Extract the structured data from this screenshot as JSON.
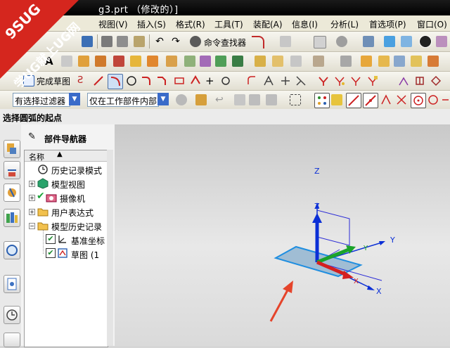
{
  "window": {
    "title": "g3.prt （修改的）]"
  },
  "menu": {
    "items": [
      "视图(V)",
      "插入(S)",
      "格式(R)",
      "工具(T)",
      "装配(A)",
      "信息(I)",
      "分析(L)",
      "首选项(P)",
      "窗口(O)"
    ]
  },
  "toolbar1": {
    "command_finder_label": "命令查找器"
  },
  "toolbar3": {
    "finish_sketch_label": "完成草图"
  },
  "selection_bar": {
    "filter_value": "有选择过滤器",
    "scope_value": "仅在工作部件内部"
  },
  "cue_line": {
    "text": "选择圆弧的起点"
  },
  "navigator": {
    "title": "部件导航器",
    "column_name": "名称",
    "items": [
      {
        "label": "历史记录模式"
      },
      {
        "label": "模型视图"
      },
      {
        "label": "摄像机"
      },
      {
        "label": "用户表达式"
      },
      {
        "label": "模型历史记录"
      },
      {
        "label": "基准坐标"
      },
      {
        "label": "草图 (1"
      }
    ]
  },
  "viewport": {
    "axis_labels": {
      "z_upper": "Z",
      "z_lower": "Z",
      "y": "Y",
      "y_small": "Y",
      "x": "X",
      "x_small": "X"
    }
  },
  "watermark": {
    "line1": "9SUG",
    "line2": "学UG就上UG网"
  },
  "colors": {
    "triad_blue": "#0b2fd6",
    "triad_green": "#1aa32a",
    "triad_red": "#d42020",
    "plane_fill": "#8fb3cf",
    "arrow_red": "#e5442b"
  }
}
